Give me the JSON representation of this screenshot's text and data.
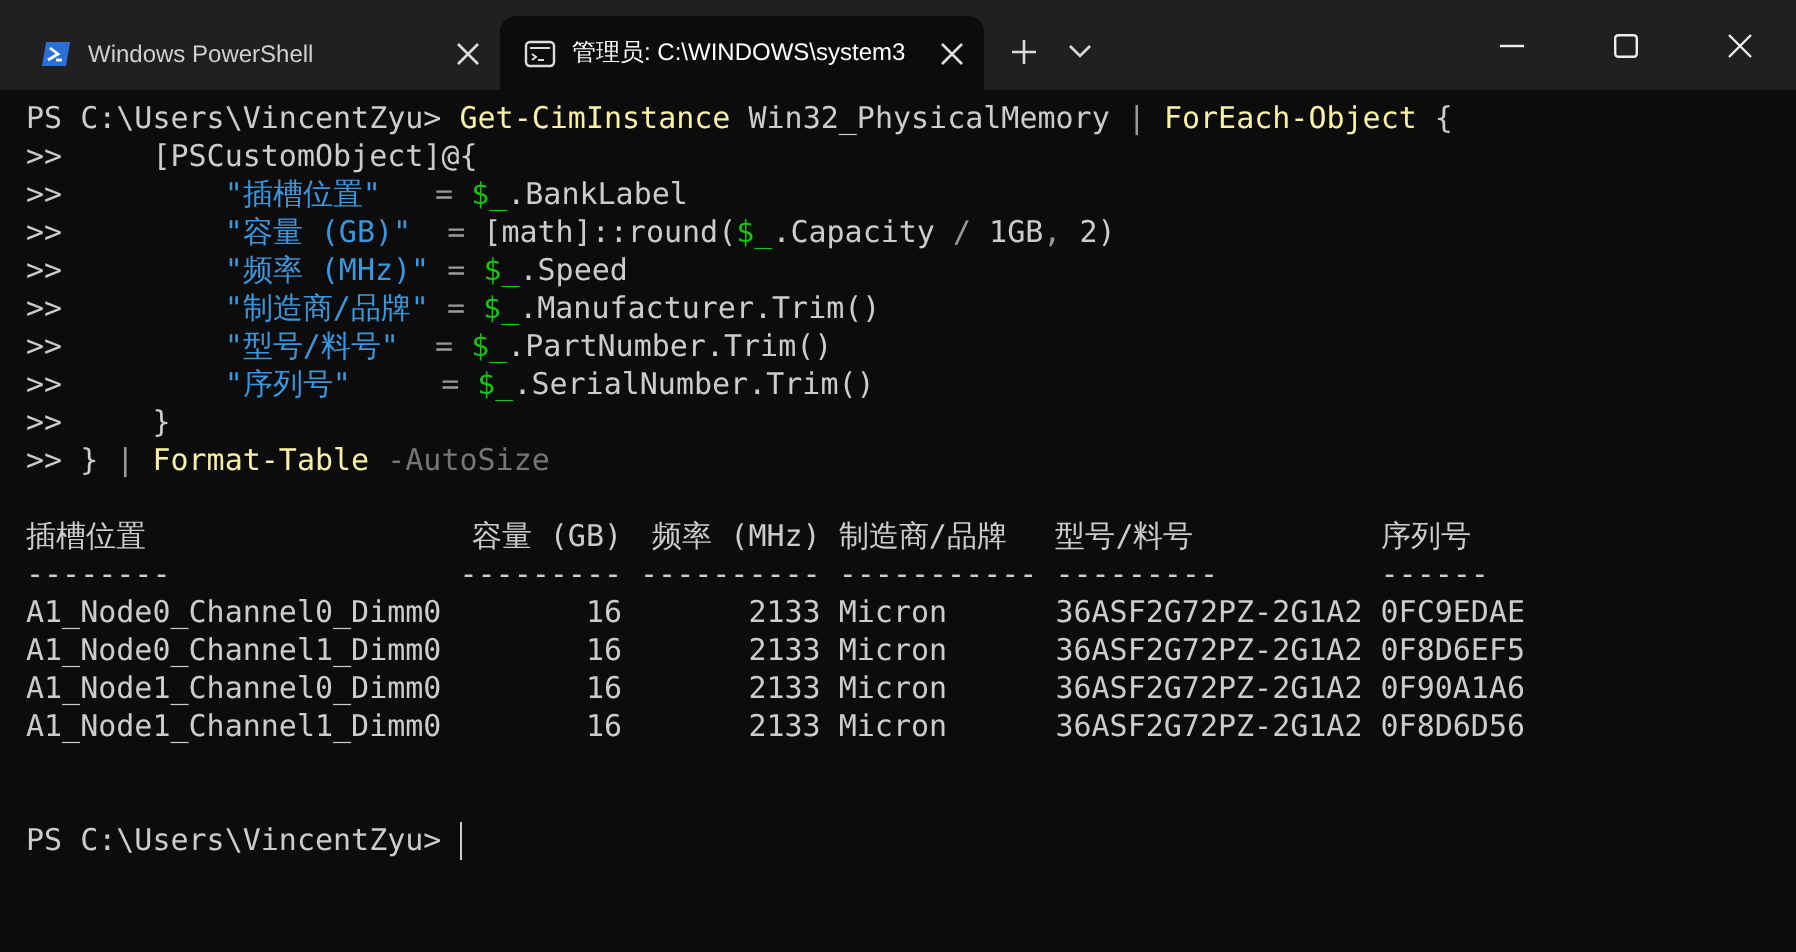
{
  "tabs": [
    {
      "title": "Windows PowerShell",
      "selected": false
    },
    {
      "title": "管理员: C:\\WINDOWS\\system3",
      "selected": true
    }
  ],
  "terminal": {
    "command_lines": [
      {
        "segments": [
          {
            "kind": "plain",
            "text": "PS C:\\Users\\VincentZyu> "
          },
          {
            "kind": "command",
            "text": "Get-CimInstance"
          },
          {
            "kind": "plain",
            "text": " Win32_PhysicalMemory "
          },
          {
            "kind": "operator",
            "text": "| "
          },
          {
            "kind": "command",
            "text": "ForEach-Object"
          },
          {
            "kind": "plain",
            "text": " {"
          }
        ]
      },
      {
        "segments": [
          {
            "kind": "plain",
            "text": ">>     [PSCustomObject]@{"
          }
        ]
      },
      {
        "segments": [
          {
            "kind": "plain",
            "text": ">>         "
          },
          {
            "kind": "string",
            "text": "\"插槽位置\"   "
          },
          {
            "kind": "operator",
            "text": "= "
          },
          {
            "kind": "variable",
            "text": "$_"
          },
          {
            "kind": "plain",
            "text": ".BankLabel"
          }
        ]
      },
      {
        "segments": [
          {
            "kind": "plain",
            "text": ">>         "
          },
          {
            "kind": "string",
            "text": "\"容量 (GB)\"  "
          },
          {
            "kind": "operator",
            "text": "="
          },
          {
            "kind": "plain",
            "text": " [math]::round("
          },
          {
            "kind": "variable",
            "text": "$_"
          },
          {
            "kind": "plain",
            "text": ".Capacity "
          },
          {
            "kind": "operator",
            "text": "/"
          },
          {
            "kind": "plain",
            "text": " 1GB"
          },
          {
            "kind": "operator",
            "text": ","
          },
          {
            "kind": "plain",
            "text": " 2)"
          }
        ]
      },
      {
        "segments": [
          {
            "kind": "plain",
            "text": ">>         "
          },
          {
            "kind": "string",
            "text": "\"频率 (MHz)\" "
          },
          {
            "kind": "operator",
            "text": "= "
          },
          {
            "kind": "variable",
            "text": "$_"
          },
          {
            "kind": "plain",
            "text": ".Speed"
          }
        ]
      },
      {
        "segments": [
          {
            "kind": "plain",
            "text": ">>         "
          },
          {
            "kind": "string",
            "text": "\"制造商/品牌\" "
          },
          {
            "kind": "operator",
            "text": "= "
          },
          {
            "kind": "variable",
            "text": "$_"
          },
          {
            "kind": "plain",
            "text": ".Manufacturer.Trim()"
          }
        ]
      },
      {
        "segments": [
          {
            "kind": "plain",
            "text": ">>         "
          },
          {
            "kind": "string",
            "text": "\"型号/料号\"  "
          },
          {
            "kind": "operator",
            "text": "= "
          },
          {
            "kind": "variable",
            "text": "$_"
          },
          {
            "kind": "plain",
            "text": ".PartNumber.Trim()"
          }
        ]
      },
      {
        "segments": [
          {
            "kind": "plain",
            "text": ">>         "
          },
          {
            "kind": "string",
            "text": "\"序列号\"     "
          },
          {
            "kind": "operator",
            "text": "= "
          },
          {
            "kind": "variable",
            "text": "$_"
          },
          {
            "kind": "plain",
            "text": ".SerialNumber.Trim()"
          }
        ]
      },
      {
        "segments": [
          {
            "kind": "plain",
            "text": ">>     }"
          }
        ]
      },
      {
        "segments": [
          {
            "kind": "plain",
            "text": ">> } "
          },
          {
            "kind": "operator",
            "text": "| "
          },
          {
            "kind": "command",
            "text": "Format-Table "
          },
          {
            "kind": "parameter",
            "text": "-AutoSize"
          }
        ]
      }
    ],
    "table": {
      "columns": [
        {
          "header": "插槽位置",
          "rule": "--------",
          "kind": "text"
        },
        {
          "header": "容量 (GB)",
          "rule": "---------",
          "kind": "numeric"
        },
        {
          "header": "频率 (MHz)",
          "rule": "----------",
          "kind": "numeric"
        },
        {
          "header": "制造商/品牌",
          "rule": "-----------",
          "kind": "text"
        },
        {
          "header": "型号/料号",
          "rule": "---------",
          "kind": "text"
        },
        {
          "header": "序列号",
          "rule": "------",
          "kind": "text"
        }
      ],
      "rows": [
        [
          "A1_Node0_Channel0_Dimm0",
          "16",
          "2133",
          "Micron",
          "36ASF2G72PZ-2G1A2",
          "0FC9EDAE"
        ],
        [
          "A1_Node0_Channel1_Dimm0",
          "16",
          "2133",
          "Micron",
          "36ASF2G72PZ-2G1A2",
          "0F8D6EF5"
        ],
        [
          "A1_Node1_Channel0_Dimm0",
          "16",
          "2133",
          "Micron",
          "36ASF2G72PZ-2G1A2",
          "0F90A1A6"
        ],
        [
          "A1_Node1_Channel1_Dimm0",
          "16",
          "2133",
          "Micron",
          "36ASF2G72PZ-2G1A2",
          "0F8D6D56"
        ]
      ]
    },
    "prompt": "PS C:\\Users\\VincentZyu> "
  }
}
